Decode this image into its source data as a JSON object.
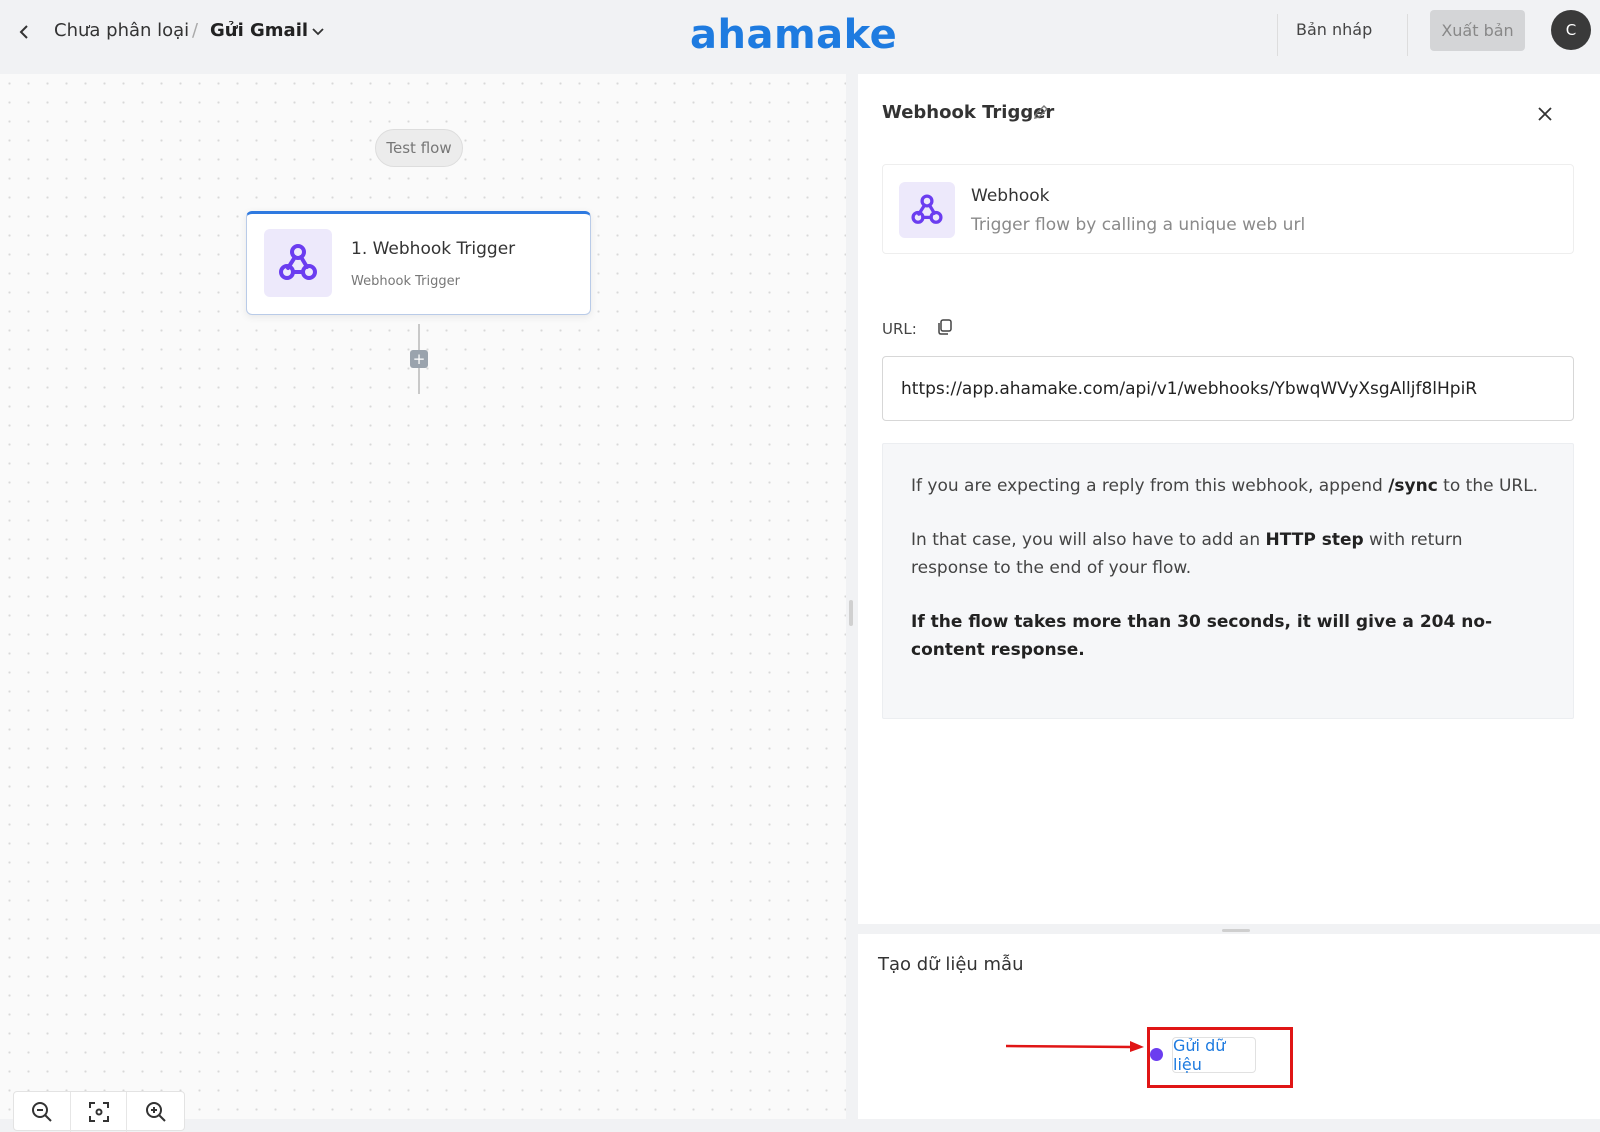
{
  "header": {
    "breadcrumb_parent": "Chưa phân loại",
    "breadcrumb_separator": "/",
    "breadcrumb_current": "Gửi Gmail",
    "logo_text": "ahamake",
    "draft_label": "Bản nháp",
    "publish_label": "Xuất bản",
    "avatar_initial": "C"
  },
  "canvas": {
    "test_flow_label": "Test flow",
    "step": {
      "title": "1. Webhook Trigger",
      "subtitle": "Webhook Trigger",
      "icon": "webhook-icon"
    },
    "add_step_label": "+",
    "zoom_controls": [
      "zoom-out-icon",
      "fit-view-icon",
      "zoom-in-icon"
    ]
  },
  "panel": {
    "title": "Webhook Trigger",
    "piece": {
      "name": "Webhook",
      "description": "Trigger flow by calling a unique web url"
    },
    "url_label": "URL:",
    "url_value": "https://app.ahamake.com/api/v1/webhooks/YbwqWVyXsgAlljf8lHpiR",
    "info": {
      "p1_before": "If you are expecting a reply from this webhook, append ",
      "p1_bold": "/sync",
      "p1_after": " to the URL.",
      "p2_before": "In that case, you will also have to add an ",
      "p2_bold": "HTTP step",
      "p2_after": " with return response to the end of your flow.",
      "p3_bold": "If the flow takes more than 30 seconds, it will give a 204 no-content response."
    }
  },
  "sample": {
    "title": "Tạo dữ liệu mẫu",
    "send_button_label": "Gửi dữ liệu"
  },
  "colors": {
    "brand_blue": "#1e7be0",
    "webhook_purple": "#6b3df0",
    "highlight_red": "#e01515"
  }
}
